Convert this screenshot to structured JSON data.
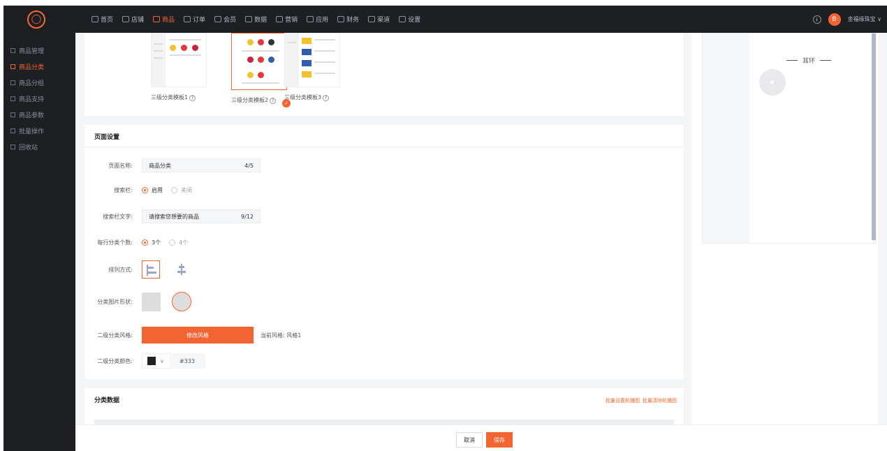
{
  "topnav": {
    "items": [
      {
        "label": "首页",
        "icon": "home-icon"
      },
      {
        "label": "店铺",
        "icon": "store-icon"
      },
      {
        "label": "商品",
        "icon": "goods-icon",
        "active": true
      },
      {
        "label": "订单",
        "icon": "order-icon"
      },
      {
        "label": "会员",
        "icon": "user-icon"
      },
      {
        "label": "数据",
        "icon": "data-icon"
      },
      {
        "label": "营销",
        "icon": "tag-icon"
      },
      {
        "label": "应用",
        "icon": "apps-icon"
      },
      {
        "label": "财务",
        "icon": "finance-icon"
      },
      {
        "label": "渠道",
        "icon": "channel-icon"
      },
      {
        "label": "设置",
        "icon": "settings-icon"
      }
    ],
    "avatar_text": "B",
    "user_name": "金福缘珠宝 ∨",
    "accent": "#f26532"
  },
  "sidebar": {
    "items": [
      {
        "label": "商品管理"
      },
      {
        "label": "商品分类",
        "active": true
      },
      {
        "label": "商品分组"
      },
      {
        "label": "商品支持"
      },
      {
        "label": "商品参数"
      },
      {
        "label": "批量操作"
      },
      {
        "label": "回收站"
      }
    ]
  },
  "templates": [
    {
      "caption": "三级分类模板1"
    },
    {
      "caption": "三级分类模板2",
      "selected": true
    },
    {
      "caption": "三级分类模板3"
    }
  ],
  "page_settings": {
    "title": "页面设置",
    "page_name": {
      "label": "页面名称:",
      "value": "商品分类",
      "count": "4/5"
    },
    "search_bar": {
      "label": "搜索栏:",
      "options": [
        "启用",
        "关闭"
      ],
      "selected": "启用"
    },
    "search_text": {
      "label": "搜索栏文字:",
      "value": "请搜索您想要的商品",
      "count": "9/12"
    },
    "per_row": {
      "label": "每行分类个数:",
      "options": [
        "3个",
        "4个"
      ],
      "selected": "3个"
    },
    "arrangement": {
      "label": "排列方式:"
    },
    "image_shape": {
      "label": "分类图片形状:"
    },
    "sub_style": {
      "label": "二级分类风格:",
      "button": "修改风格",
      "current": "当前风格: 风格1"
    },
    "sub_color": {
      "label": "二级分类颜色:",
      "hex": "#333",
      "swatch": "#222222"
    }
  },
  "category_data": {
    "title": "分类数据",
    "link1": "批量设置轮播图",
    "link2": "批量清除轮播图"
  },
  "preview": {
    "category_title": "耳环"
  },
  "footer": {
    "cancel": "取消",
    "save": "保存"
  }
}
